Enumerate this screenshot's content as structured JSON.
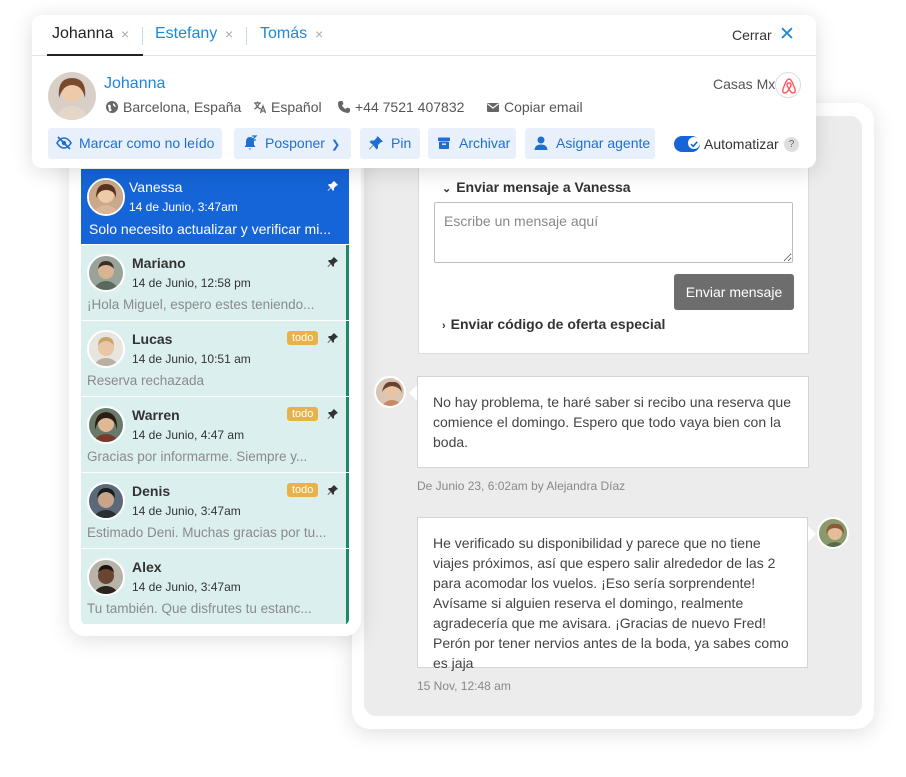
{
  "tabs": [
    {
      "label": "Johanna"
    },
    {
      "label": "Estefany"
    },
    {
      "label": "Tomás"
    }
  ],
  "close_label": "Cerrar",
  "contact": {
    "name": "Johanna",
    "location": "Barcelona, España",
    "language": "Español",
    "phone": "+44 7521 407832",
    "email_action": "Copiar email",
    "source": "Casas Mx",
    "source_icon": "airbnb-icon"
  },
  "actions": {
    "mark_unread": "Marcar como no leído",
    "postpone": "Posponer",
    "pin": "Pin",
    "archive": "Archivar",
    "assign_agent": "Asignar agente",
    "automate": "Automatizar",
    "automate_on": true,
    "help": "?"
  },
  "conversations": [
    {
      "name": "Vanessa",
      "date": "14 de Junio, 3:47am",
      "preview": "Solo necesito actualizar y verificar mi...",
      "badge": "",
      "pinned": true,
      "active": true
    },
    {
      "name": "Mariano",
      "date": "14 de Junio, 12:58 pm",
      "preview": "¡Hola Miguel, espero estes teniendo...",
      "badge": "",
      "pinned": true,
      "active": false
    },
    {
      "name": "Lucas",
      "date": "14 de Junio, 10:51 am",
      "preview": "Reserva rechazada",
      "badge": "todo",
      "pinned": true,
      "active": false
    },
    {
      "name": "Warren",
      "date": "14 de Junio, 4:47 am",
      "preview": "Gracias por informarme. Siempre y...",
      "badge": "todo",
      "pinned": true,
      "active": false
    },
    {
      "name": "Denis",
      "date": "14 de Junio, 3:47am",
      "preview": "Estimado Deni. Muchas gracias por tu...",
      "badge": "todo",
      "pinned": true,
      "active": false
    },
    {
      "name": "Alex",
      "date": "14 de Junio, 3:47am",
      "preview": "Tu también. Que disfrutes tu estanc...",
      "badge": "",
      "pinned": false,
      "active": false
    }
  ],
  "compose": {
    "title": "Enviar mensaje a Vanessa",
    "placeholder": "Escribe un mensaje aquí",
    "send_label": "Enviar mensaje",
    "offer_title": "Enviar código de oferta especial"
  },
  "messages": [
    {
      "text": "No hay problema, te haré saber si recibo una reserva que comience el domingo. Espero que todo vaya bien con la boda.",
      "meta": "De Junio 23, 6:02am by Alejandra Díaz"
    },
    {
      "text": "He verificado su disponibilidad y parece que no tiene viajes próximos, así que espero salir alrededor de las 2 para acomodar los vuelos. ¡Eso sería sorprendente! Avísame si alguien reserva el domingo, realmente agradecería que me avisara. ¡Gracias de nuevo Fred! Perón por tener nervios antes de la boda, ya sabes como es jaja",
      "meta": "15 Nov, 12:48 am"
    }
  ],
  "colors": {
    "accent": "#1e88d6",
    "active_row": "#1565d8",
    "list_bg": "#dcefef",
    "todo_badge": "#e8b24a",
    "send_button": "#6d6d6d"
  }
}
